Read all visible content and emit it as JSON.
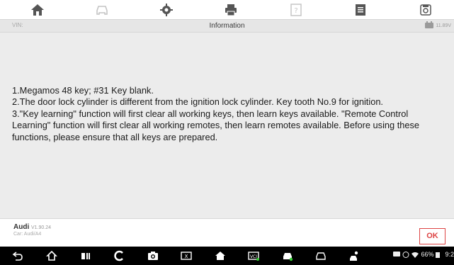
{
  "toolbar": {
    "icons": [
      "home-icon",
      "car-icon",
      "gear-icon",
      "printer-icon",
      "help-icon",
      "log-icon",
      "save-icon"
    ]
  },
  "titlebar": {
    "vin_label": "VIN:",
    "title": "Information",
    "battery_voltage": "11.89V"
  },
  "message": {
    "lines": [
      "1.Megamos 48 key; #31 Key blank.",
      "2.The door lock cylinder is different from the ignition lock cylinder. Key tooth No.9 for ignition.",
      "3.\"Key learning\" function will first clear all working keys, then learn keys available. \"Remote Control Learning\" function will first clear all working remotes, then learn remotes available. Before using these functions, please ensure that all keys are prepared."
    ]
  },
  "footer": {
    "brand": "Audi",
    "version": "V1.90.24",
    "car": "Car: Audi/A4",
    "ok_label": "OK"
  },
  "statusbar": {
    "battery": "66%",
    "time": "9:2"
  },
  "colors": {
    "accent": "#dd4444",
    "content_bg": "#ececec",
    "titlebar_bg": "#e6e6e6"
  }
}
